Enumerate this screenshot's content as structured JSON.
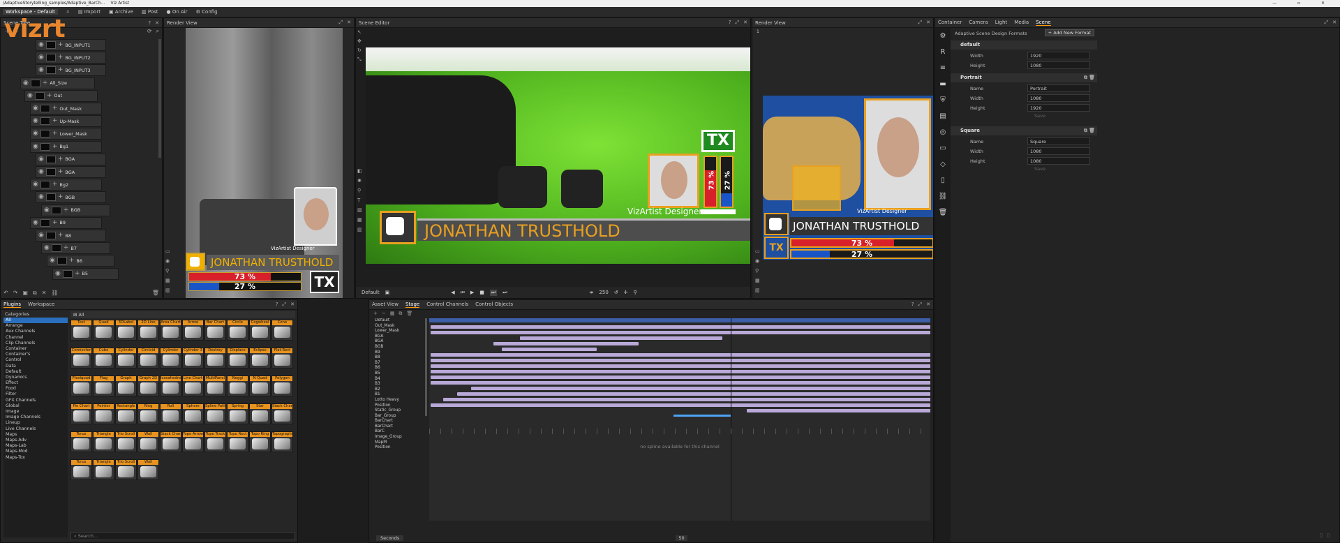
{
  "window": {
    "path": "/AdaptiveStorytelling_samples/Adaptive_BarCh...",
    "app": "Viz Artist"
  },
  "menu": {
    "workspace": "Workspace - Default",
    "import": "Import",
    "archive": "Archive",
    "post": "Post",
    "onair": "On Air",
    "config": "Config"
  },
  "logo": "vizrt",
  "scene_tree": {
    "title": "Scene Tree",
    "nodes": [
      "BG_INPUT1",
      "BG_INPUT2",
      "BG_INPUT3",
      "All_Size",
      "Out",
      "Out_Mask",
      "Up-Mask",
      "Lower_Mask",
      "Bg1",
      "BGA",
      "BGA",
      "Bg2",
      "BGB",
      "BGB",
      "B9",
      "B8",
      "B7",
      "B6",
      "B5"
    ]
  },
  "render_left": {
    "title": "Render View"
  },
  "scene_editor": {
    "title": "Scene Editor",
    "default_label": "Default",
    "zoom": "250"
  },
  "render_right": {
    "title": "Render View",
    "frame": "1"
  },
  "graphic": {
    "name": "JONATHAN TRUSTHOLD",
    "role": "VizArtist Designer",
    "role_small": "VizArtist Designer",
    "pct1": "73 %",
    "pct2": "27 %",
    "tx": "TX"
  },
  "props": {
    "tabs": [
      "Container",
      "Camera",
      "Light",
      "Media",
      "Scene"
    ],
    "heading": "Adaptive Scene Design Formats",
    "add_button": "Add New Format",
    "sections": [
      {
        "title": "default",
        "fields": [
          {
            "k": "Width",
            "v": "1920"
          },
          {
            "k": "Height",
            "v": "1080"
          }
        ]
      },
      {
        "title": "Portrait",
        "fields": [
          {
            "k": "Name",
            "v": "Portrait"
          },
          {
            "k": "Width",
            "v": "1080"
          },
          {
            "k": "Height",
            "v": "1920"
          }
        ],
        "save": "Save"
      },
      {
        "title": "Square",
        "fields": [
          {
            "k": "Name",
            "v": "Square"
          },
          {
            "k": "Width",
            "v": "1080"
          },
          {
            "k": "Height",
            "v": "1080"
          }
        ],
        "save": "Save"
      }
    ]
  },
  "plugins": {
    "tabs": [
      "Plugins",
      "Workspace"
    ],
    "all": "All",
    "categories_title": "Categories",
    "categories": [
      "All",
      "Arrange",
      "Aux Channels",
      "Channel",
      "Clip Channels",
      "Container",
      "Container's",
      "Control",
      "Data",
      "Default",
      "Dynamics",
      "Effect",
      "Food",
      "Filter",
      "GFX Channels",
      "Global",
      "Image",
      "Image Channels",
      "Lineup",
      "Live Channels",
      "Maps",
      "Maps-Adv",
      "Maps-Lab",
      "Maps-Mod",
      "Maps-Tox"
    ],
    "items": [
      "Text",
      "Quad",
      "3DLabel",
      "2D Line",
      "Area Chart",
      "Arrow",
      "Bar Chart",
      "Circle",
      "Cogwheel",
      "Cone",
      "Connector",
      "Cube",
      "Cylinder",
      "Circloid",
      "Cylinder",
      "Cylinder 3",
      "Destroy",
      "Displace",
      "Eclipse",
      "Flat-Rect",
      "Flexiquad",
      "Flag",
      "Graph",
      "Graph 2D",
      "Icosahedron",
      "Line Chart",
      "MultiPanel",
      "Noggi",
      "N Quad",
      "Polygon",
      "Pie Chart",
      "Pointer",
      "Rectangle",
      "Ring",
      "Roll",
      "Sphere",
      "Spline Path",
      "Spring",
      "Star",
      "Stack Chart",
      "Torus",
      "Triangle",
      "Trio Scroll",
      "Wall",
      "Stack Chart",
      "Topo Arrow",
      "Topo Track",
      "Topo Rect",
      "Topo Ring",
      "Topographic",
      "Torus",
      "Triangle",
      "Trio Scroll",
      "Wall"
    ],
    "search_placeholder": "Search..."
  },
  "stage": {
    "tabs": [
      "Asset View",
      "Stage",
      "Control Channels",
      "Control Objects"
    ],
    "tree": [
      "Default",
      "Out_Mask",
      "Lower_Mask",
      "BGA",
      "BGA",
      "BGB",
      "B9",
      "B8",
      "B7",
      "B6",
      "B5",
      "B4",
      "B3",
      "B2",
      "B1",
      "Lotto Heavy",
      "Position",
      "Static_Group",
      "Bar_Group",
      "BarChart",
      "BarChart",
      "BarC",
      "Image_Group",
      "MapM",
      "Position"
    ],
    "no_spline": "no spline available for this channel",
    "unit": "Seconds",
    "frame": "50"
  }
}
